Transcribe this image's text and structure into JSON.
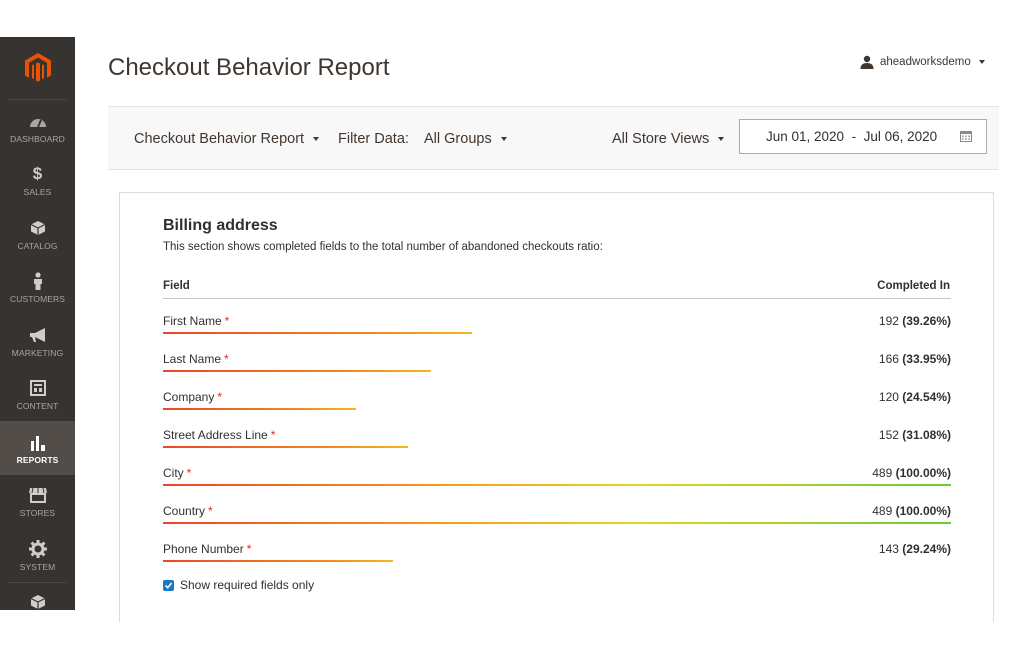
{
  "sidebar": {
    "items": [
      {
        "label": "DASHBOARD",
        "icon": "dashboard-icon"
      },
      {
        "label": "SALES",
        "icon": "dollar-icon"
      },
      {
        "label": "CATALOG",
        "icon": "box-icon"
      },
      {
        "label": "CUSTOMERS",
        "icon": "person-icon"
      },
      {
        "label": "MARKETING",
        "icon": "megaphone-icon"
      },
      {
        "label": "CONTENT",
        "icon": "layout-icon"
      },
      {
        "label": "REPORTS",
        "icon": "bar-chart-icon"
      },
      {
        "label": "STORES",
        "icon": "store-icon"
      },
      {
        "label": "SYSTEM",
        "icon": "gear-icon"
      }
    ],
    "active": "REPORTS",
    "accent": "#eb5202"
  },
  "header": {
    "title": "Checkout Behavior Report",
    "user": "aheadworksdemo"
  },
  "toolbar": {
    "report_label": "Checkout Behavior Report",
    "filter_label": "Filter Data:",
    "group_value": "All Groups",
    "store_value": "All Store Views",
    "date_range": "Jun 01, 2020  -  Jul 06, 2020"
  },
  "section": {
    "title": "Billing address",
    "description": "This section shows completed fields to the total number of abandoned checkouts ratio:",
    "col_field": "Field",
    "col_completed": "Completed In",
    "required_mark": "*",
    "rows": [
      {
        "name": "First Name",
        "count": "192",
        "pct": "(39.26%)",
        "fraction": 0.3926
      },
      {
        "name": "Last Name",
        "count": "166",
        "pct": "(33.95%)",
        "fraction": 0.3395
      },
      {
        "name": "Company",
        "count": "120",
        "pct": "(24.54%)",
        "fraction": 0.2454
      },
      {
        "name": "Street Address Line",
        "count": "152",
        "pct": "(31.08%)",
        "fraction": 0.3108
      },
      {
        "name": "City",
        "count": "489",
        "pct": "(100.00%)",
        "fraction": 1.0
      },
      {
        "name": "Country",
        "count": "489",
        "pct": "(100.00%)",
        "fraction": 1.0
      },
      {
        "name": "Phone Number",
        "count": "143",
        "pct": "(29.24%)",
        "fraction": 0.2924
      }
    ],
    "checkbox_label": "Show required fields only",
    "checkbox_checked": true
  }
}
